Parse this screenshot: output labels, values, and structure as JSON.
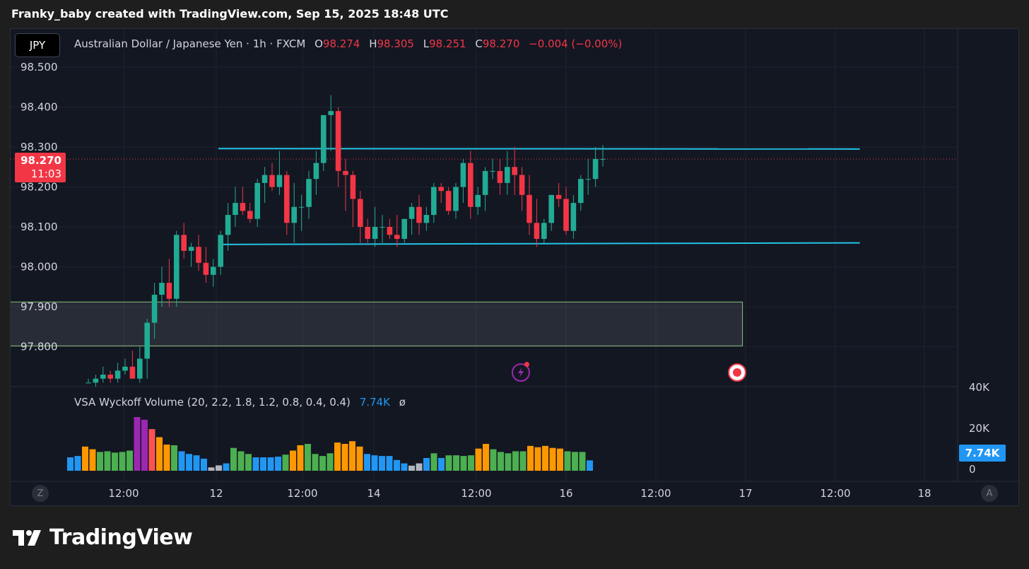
{
  "header": {
    "attribution": "Franky_baby created with TradingView.com, Sep 15, 2025 18:48 UTC"
  },
  "symbol_button": "JPY",
  "legend": {
    "title": "Australian Dollar / Japanese Yen · 1h · FXCM",
    "o_label": "O",
    "o_value": "98.274",
    "h_label": "H",
    "h_value": "98.305",
    "l_label": "L",
    "l_value": "98.251",
    "c_label": "C",
    "c_value": "98.270",
    "change": "−0.004 (−0.00%)"
  },
  "price_tag": {
    "price": "98.270",
    "countdown": "11:03"
  },
  "indicator": {
    "name": "VSA Wyckoff Volume (20, 2.2, 1.8, 1.2, 0.8, 0.4, 0.4)",
    "value": "7.74K",
    "extra": "ø"
  },
  "volume_tag": "7.74K",
  "buttons": {
    "timezone": "Z",
    "auto_scale": "A"
  },
  "footer": {
    "brand": "TradingView"
  },
  "colors": {
    "up": "#22ab94",
    "down": "#f23645",
    "level_line": "#22c3e6",
    "zone_border": "#8bc37a",
    "background": "#131722"
  },
  "chart_data": {
    "type": "candlestick",
    "symbol": "Australian Dollar / Japanese Yen",
    "interval": "1h",
    "last_price": 98.27,
    "y_ticks": [
      "98.500",
      "98.400",
      "98.300",
      "98.200",
      "98.100",
      "98.000",
      "97.900",
      "97.800"
    ],
    "x_ticks": [
      "12:00",
      "12",
      "12:00",
      "14",
      "12:00",
      "16",
      "12:00",
      "17",
      "12:00",
      "18"
    ],
    "volume_ticks": [
      "40K",
      "20K",
      "0"
    ],
    "levels": [
      {
        "type": "resistance",
        "price_start": 98.296,
        "price_end": 98.295,
        "from_bar": 0,
        "to_bar": 104
      },
      {
        "type": "support",
        "price_start": 98.056,
        "price_end": 98.06,
        "from_bar": 0,
        "to_bar": 104
      }
    ],
    "zone": {
      "top": 97.912,
      "bottom": 97.802,
      "from_bar": -25,
      "to_bar": 89
    },
    "candles": [
      [
        97.71,
        97.72,
        97.71,
        97.71
      ],
      [
        97.71,
        97.73,
        97.7,
        97.72
      ],
      [
        97.72,
        97.75,
        97.71,
        97.73
      ],
      [
        97.73,
        97.74,
        97.71,
        97.72
      ],
      [
        97.72,
        97.76,
        97.71,
        97.74
      ],
      [
        97.74,
        97.77,
        97.73,
        97.75
      ],
      [
        97.75,
        97.79,
        97.73,
        97.72
      ],
      [
        97.72,
        97.8,
        97.71,
        97.77
      ],
      [
        97.77,
        97.87,
        97.72,
        97.86
      ],
      [
        97.86,
        97.96,
        97.82,
        97.93
      ],
      [
        97.93,
        98.0,
        97.9,
        97.96
      ],
      [
        97.96,
        98.02,
        97.9,
        97.92
      ],
      [
        97.92,
        98.09,
        97.9,
        98.08
      ],
      [
        98.08,
        98.11,
        98.02,
        98.04
      ],
      [
        98.04,
        98.06,
        98.0,
        98.05
      ],
      [
        98.05,
        98.08,
        97.99,
        98.01
      ],
      [
        98.01,
        98.05,
        97.96,
        97.98
      ],
      [
        97.98,
        98.02,
        97.95,
        98.0
      ],
      [
        98.0,
        98.09,
        97.98,
        98.08
      ],
      [
        98.08,
        98.16,
        98.04,
        98.13
      ],
      [
        98.13,
        98.2,
        98.1,
        98.16
      ],
      [
        98.16,
        98.2,
        98.13,
        98.14
      ],
      [
        98.14,
        98.16,
        98.11,
        98.12
      ],
      [
        98.12,
        98.22,
        98.1,
        98.21
      ],
      [
        98.21,
        98.25,
        98.16,
        98.23
      ],
      [
        98.23,
        98.26,
        98.19,
        98.2
      ],
      [
        98.2,
        98.29,
        98.18,
        98.23
      ],
      [
        98.23,
        98.24,
        98.08,
        98.11
      ],
      [
        98.11,
        98.21,
        98.06,
        98.15
      ],
      [
        98.15,
        98.18,
        98.09,
        98.15
      ],
      [
        98.15,
        98.24,
        98.12,
        98.22
      ],
      [
        98.22,
        98.29,
        98.18,
        98.26
      ],
      [
        98.26,
        98.34,
        98.24,
        98.38
      ],
      [
        98.38,
        98.43,
        98.29,
        98.39
      ],
      [
        98.39,
        98.4,
        98.2,
        98.24
      ],
      [
        98.24,
        98.27,
        98.14,
        98.23
      ],
      [
        98.23,
        98.24,
        98.1,
        98.17
      ],
      [
        98.17,
        98.19,
        98.06,
        98.1
      ],
      [
        98.1,
        98.12,
        98.06,
        98.07
      ],
      [
        98.07,
        98.15,
        98.05,
        98.1
      ],
      [
        98.1,
        98.13,
        98.06,
        98.1
      ],
      [
        98.1,
        98.12,
        98.07,
        98.08
      ],
      [
        98.08,
        98.13,
        98.05,
        98.07
      ],
      [
        98.07,
        98.11,
        98.06,
        98.12
      ],
      [
        98.12,
        98.16,
        98.08,
        98.15
      ],
      [
        98.15,
        98.18,
        98.08,
        98.11
      ],
      [
        98.11,
        98.15,
        98.09,
        98.13
      ],
      [
        98.13,
        98.21,
        98.11,
        98.2
      ],
      [
        98.2,
        98.21,
        98.16,
        98.19
      ],
      [
        98.19,
        98.2,
        98.13,
        98.14
      ],
      [
        98.14,
        98.21,
        98.12,
        98.2
      ],
      [
        98.2,
        98.27,
        98.16,
        98.26
      ],
      [
        98.26,
        98.29,
        98.12,
        98.15
      ],
      [
        98.15,
        98.2,
        98.13,
        98.18
      ],
      [
        98.18,
        98.25,
        98.14,
        98.24
      ],
      [
        98.24,
        98.27,
        98.22,
        98.24
      ],
      [
        98.24,
        98.27,
        98.18,
        98.21
      ],
      [
        98.21,
        98.29,
        98.18,
        98.25
      ],
      [
        98.25,
        98.3,
        98.18,
        98.23
      ],
      [
        98.23,
        98.25,
        98.14,
        98.18
      ],
      [
        98.18,
        98.23,
        98.08,
        98.11
      ],
      [
        98.11,
        98.17,
        98.05,
        98.07
      ],
      [
        98.07,
        98.12,
        98.06,
        98.11
      ],
      [
        98.11,
        98.18,
        98.09,
        98.18
      ],
      [
        98.18,
        98.21,
        98.15,
        98.17
      ],
      [
        98.17,
        98.2,
        98.08,
        98.09
      ],
      [
        98.09,
        98.18,
        98.07,
        98.16
      ],
      [
        98.16,
        98.23,
        98.14,
        98.22
      ],
      [
        98.22,
        98.27,
        98.18,
        98.22
      ],
      [
        98.22,
        98.3,
        98.2,
        98.27
      ],
      [
        98.27,
        98.305,
        98.251,
        98.27
      ]
    ],
    "volume": [
      {
        "v": 10000,
        "c": "blue"
      },
      {
        "v": 11000,
        "c": "blue"
      },
      {
        "v": 18000,
        "c": "orange"
      },
      {
        "v": 16000,
        "c": "orange"
      },
      {
        "v": 14000,
        "c": "green"
      },
      {
        "v": 14500,
        "c": "green"
      },
      {
        "v": 13500,
        "c": "green"
      },
      {
        "v": 14000,
        "c": "green"
      },
      {
        "v": 15000,
        "c": "green"
      },
      {
        "v": 40000,
        "c": "purple"
      },
      {
        "v": 38000,
        "c": "purple"
      },
      {
        "v": 31000,
        "c": "salmon"
      },
      {
        "v": 25000,
        "c": "orange"
      },
      {
        "v": 19500,
        "c": "orange"
      },
      {
        "v": 19000,
        "c": "green"
      },
      {
        "v": 14500,
        "c": "blue"
      },
      {
        "v": 12500,
        "c": "blue"
      },
      {
        "v": 11500,
        "c": "blue"
      },
      {
        "v": 9000,
        "c": "blue"
      },
      {
        "v": 2500,
        "c": "gray"
      },
      {
        "v": 4000,
        "c": "gray"
      },
      {
        "v": 5500,
        "c": "blue"
      },
      {
        "v": 17000,
        "c": "green"
      },
      {
        "v": 14500,
        "c": "green"
      },
      {
        "v": 12500,
        "c": "green"
      },
      {
        "v": 10000,
        "c": "blue"
      },
      {
        "v": 10000,
        "c": "blue"
      },
      {
        "v": 10000,
        "c": "blue"
      },
      {
        "v": 10500,
        "c": "blue"
      },
      {
        "v": 12000,
        "c": "green"
      },
      {
        "v": 15000,
        "c": "orange"
      },
      {
        "v": 19000,
        "c": "orange"
      },
      {
        "v": 20000,
        "c": "green"
      },
      {
        "v": 12500,
        "c": "green"
      },
      {
        "v": 11000,
        "c": "green"
      },
      {
        "v": 13000,
        "c": "green"
      },
      {
        "v": 21000,
        "c": "orange"
      },
      {
        "v": 20000,
        "c": "orange"
      },
      {
        "v": 22000,
        "c": "orange"
      },
      {
        "v": 18000,
        "c": "orange"
      },
      {
        "v": 12500,
        "c": "blue"
      },
      {
        "v": 11500,
        "c": "blue"
      },
      {
        "v": 11000,
        "c": "blue"
      },
      {
        "v": 11000,
        "c": "blue"
      },
      {
        "v": 8000,
        "c": "blue"
      },
      {
        "v": 5500,
        "c": "blue"
      },
      {
        "v": 3800,
        "c": "gray"
      },
      {
        "v": 5500,
        "c": "gray"
      },
      {
        "v": 9500,
        "c": "blue"
      },
      {
        "v": 13000,
        "c": "green"
      },
      {
        "v": 9500,
        "c": "blue"
      },
      {
        "v": 11500,
        "c": "green"
      },
      {
        "v": 11500,
        "c": "green"
      },
      {
        "v": 11000,
        "c": "green"
      },
      {
        "v": 11500,
        "c": "green"
      },
      {
        "v": 16500,
        "c": "orange"
      },
      {
        "v": 20000,
        "c": "orange"
      },
      {
        "v": 16000,
        "c": "green"
      },
      {
        "v": 14000,
        "c": "green"
      },
      {
        "v": 13000,
        "c": "green"
      },
      {
        "v": 14500,
        "c": "green"
      },
      {
        "v": 14500,
        "c": "green"
      },
      {
        "v": 18500,
        "c": "orange"
      },
      {
        "v": 17500,
        "c": "orange"
      },
      {
        "v": 18500,
        "c": "orange"
      },
      {
        "v": 17000,
        "c": "orange"
      },
      {
        "v": 16500,
        "c": "orange"
      },
      {
        "v": 14500,
        "c": "green"
      },
      {
        "v": 14000,
        "c": "green"
      },
      {
        "v": 14000,
        "c": "green"
      },
      {
        "v": 7740,
        "c": "blue"
      }
    ]
  }
}
